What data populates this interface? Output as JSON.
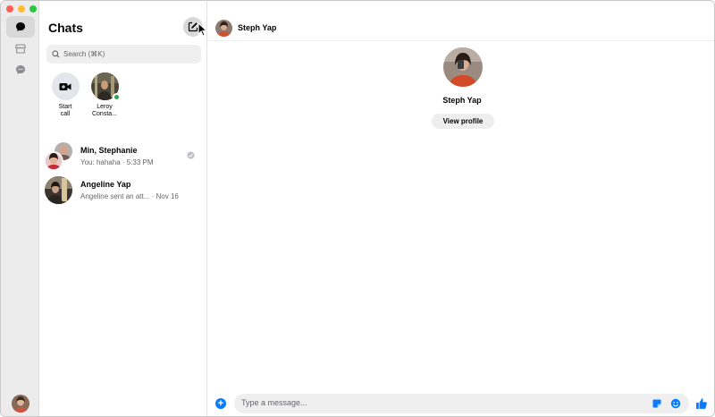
{
  "sidebar": {
    "icons": [
      "chat-bubble-icon",
      "marketplace-store-icon",
      "message-requests-icon"
    ]
  },
  "chat_list": {
    "title": "Chats",
    "search_placeholder": "Search (⌘K)",
    "stories": [
      {
        "label_line1": "Start",
        "label_line2": "call",
        "icon": "video-call-icon"
      },
      {
        "label_line1": "Leroy",
        "label_line2": "Consta...",
        "online": true
      }
    ],
    "chats": [
      {
        "name": "Min, Stephanie",
        "preview": "You: hahaha",
        "time": "5:33 PM",
        "separator": " · "
      },
      {
        "name": "Angeline Yap",
        "preview": "Angeline sent an att...",
        "time": "Nov 16",
        "separator": " · "
      }
    ]
  },
  "conversation": {
    "header_name": "Steph Yap",
    "profile_name": "Steph Yap",
    "view_profile_label": "View profile",
    "message_placeholder": "Type a message..."
  },
  "colors": {
    "accent": "#0a7cff",
    "online": "#31a24c",
    "rail_bg": "#ececec",
    "input_bg": "#efefef"
  }
}
